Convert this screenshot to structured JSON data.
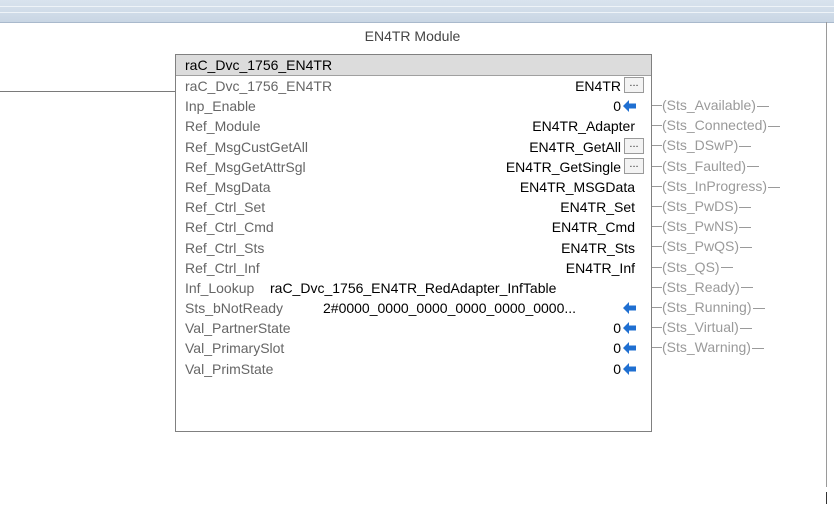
{
  "window": {
    "block_caption": "EN4TR Module"
  },
  "block": {
    "header": "raC_Dvc_1756_EN4TR",
    "rows": [
      {
        "param": "raC_Dvc_1756_EN4TR",
        "value": "EN4TR",
        "button": "..."
      },
      {
        "param": "Inp_Enable",
        "value": "0",
        "arrow": "left-arrow-icon"
      },
      {
        "param": "Ref_Module",
        "value": "EN4TR_Adapter"
      },
      {
        "param": "Ref_MsgCustGetAll",
        "value": "EN4TR_GetAll",
        "button": "..."
      },
      {
        "param": "Ref_MsgGetAttrSgl",
        "value": "EN4TR_GetSingle",
        "button": "..."
      },
      {
        "param": "Ref_MsgData",
        "value": "EN4TR_MSGData"
      },
      {
        "param": "Ref_Ctrl_Set",
        "value": "EN4TR_Set"
      },
      {
        "param": "Ref_Ctrl_Cmd",
        "value": "EN4TR_Cmd"
      },
      {
        "param": "Ref_Ctrl_Sts",
        "value": "EN4TR_Sts"
      },
      {
        "param": "Ref_Ctrl_Inf",
        "value": "EN4TR_Inf"
      },
      {
        "param": "Inf_Lookup",
        "value": "raC_Dvc_1756_EN4TR_RedAdapter_InfTable"
      },
      {
        "param": "Sts_bNotReady",
        "value": "2#0000_0000_0000_0000_0000_0000...",
        "arrow": "left-arrow-icon"
      },
      {
        "param": "Val_PartnerState",
        "value": "0",
        "arrow": "left-arrow-icon"
      },
      {
        "param": "Val_PrimarySlot",
        "value": "0",
        "arrow": "left-arrow-icon"
      },
      {
        "param": "Val_PrimState",
        "value": "0",
        "arrow": "left-arrow-icon"
      }
    ]
  },
  "outputs": [
    "Sts_Available",
    "Sts_Connected",
    "Sts_DSwP",
    "Sts_Faulted",
    "Sts_InProgress",
    "Sts_PwDS",
    "Sts_PwNS",
    "Sts_PwQS",
    "Sts_QS",
    "Sts_Ready",
    "Sts_Running",
    "Sts_Virtual",
    "Sts_Warning"
  ],
  "colors": {
    "arrow": "#1f6fd1",
    "param_text": "#666666",
    "output_text": "#9a9a9a"
  }
}
